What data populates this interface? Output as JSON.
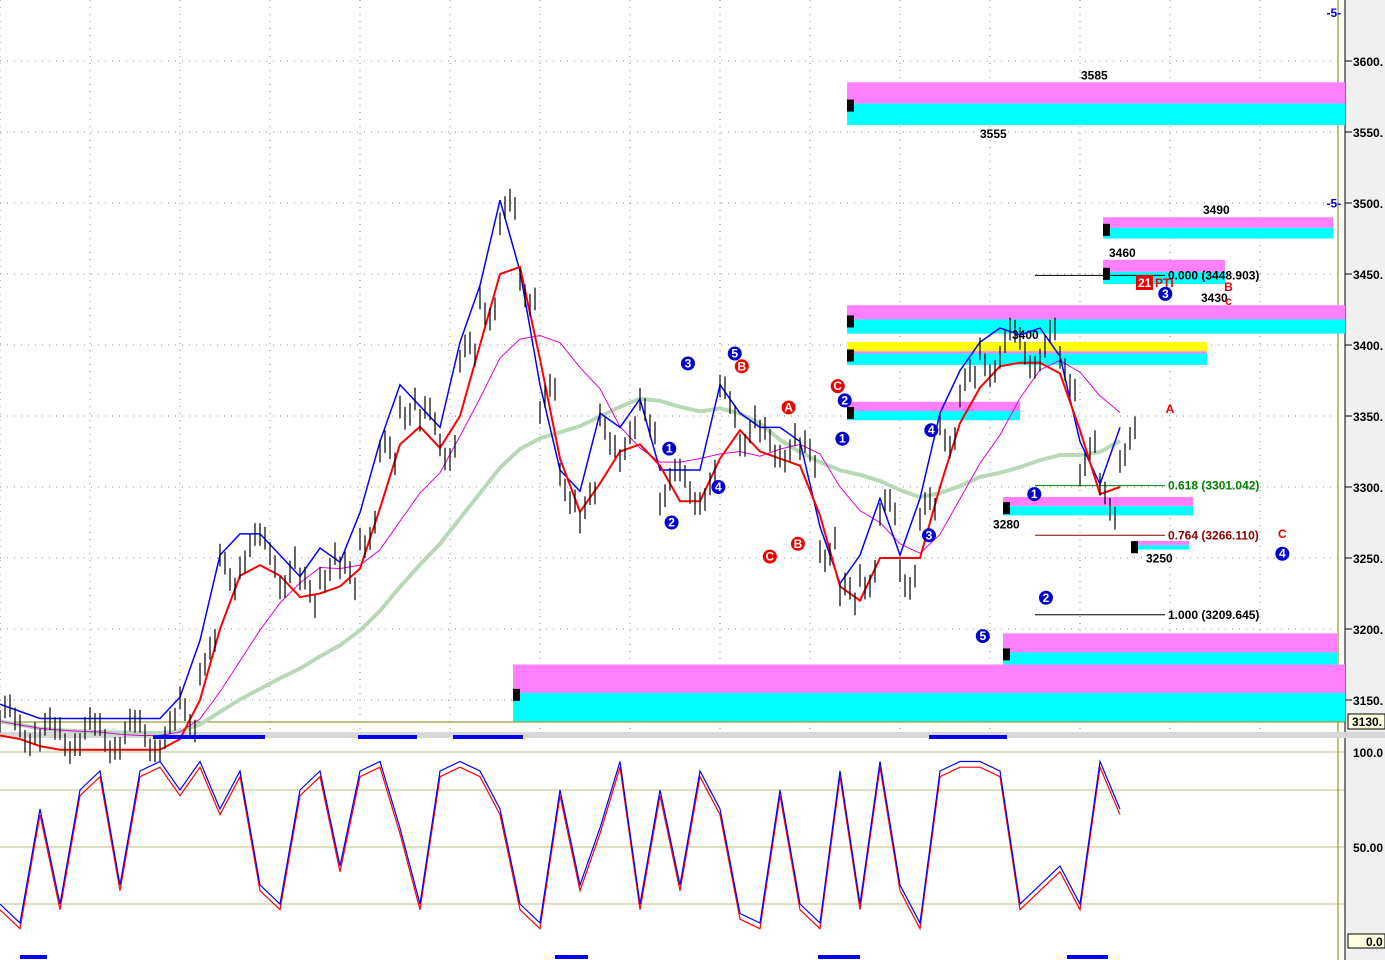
{
  "chart_data": {
    "type": "line",
    "title": "",
    "price_axis": {
      "ticks": [
        3600,
        3550,
        3500,
        3450,
        3400,
        3350,
        3300,
        3250,
        3200,
        3150
      ],
      "tick_labels": [
        "3600.",
        "3550.",
        "3500.",
        "3450.",
        "3400.",
        "3350.",
        "3300.",
        "3250.",
        "3200.",
        "3150."
      ],
      "current_label": "3130.",
      "ylim": [
        3125,
        3640
      ]
    },
    "osc_axis": {
      "ticks": [
        100,
        50
      ],
      "tick_labels": [
        "100.0",
        "50.00"
      ],
      "current_label": "0.0",
      "ylim": [
        0,
        110
      ]
    },
    "bars": 57,
    "series": [
      {
        "name": "price",
        "color": "#000000",
        "values": [
          3135,
          3130,
          3125,
          3125,
          3125,
          3125,
          3125,
          3125,
          3125,
          3140,
          3180,
          3240,
          3255,
          3255,
          3240,
          3225,
          3245,
          3235,
          3270,
          3320,
          3360,
          3345,
          3330,
          3390,
          3430,
          3490,
          3440,
          3360,
          3300,
          3285,
          3340,
          3330,
          3350,
          3300,
          3300,
          3300,
          3360,
          3340,
          3330,
          3330,
          3320,
          3260,
          3220,
          3240,
          3280,
          3240,
          3280,
          3340,
          3370,
          3390,
          3400,
          3395,
          3400,
          3380,
          3320,
          3290,
          3330
        ]
      },
      {
        "name": "osc_k",
        "color": "#0000ff",
        "values": [
          20,
          10,
          70,
          20,
          80,
          90,
          30,
          90,
          95,
          80,
          95,
          70,
          90,
          30,
          20,
          80,
          90,
          40,
          90,
          95,
          60,
          20,
          90,
          95,
          90,
          70,
          20,
          10,
          80,
          30,
          60,
          95,
          20,
          80,
          30,
          90,
          70,
          15,
          10,
          80,
          20,
          10,
          90,
          20,
          95,
          30,
          10,
          90,
          95,
          95,
          90,
          20,
          30,
          40,
          20,
          95,
          70
        ]
      }
    ],
    "zones": [
      {
        "top": 3585,
        "bottom": 3555,
        "label_top": "3585",
        "label_bottom": "3555"
      },
      {
        "top": 3490,
        "bottom": 3475,
        "label_top": "3490"
      },
      {
        "top": 3460,
        "bottom": 3443,
        "label_top": "3460"
      },
      {
        "top": 3428,
        "bottom": 3408,
        "label_top": "3430"
      },
      {
        "top": 3402,
        "bottom": 3386,
        "label_top": "3400"
      },
      {
        "top": 3360,
        "bottom": 3347
      },
      {
        "top": 3293,
        "bottom": 3280,
        "label_bottom": "3280"
      },
      {
        "top": 3262,
        "bottom": 3256,
        "label_bottom": "3250"
      },
      {
        "top": 3197,
        "bottom": 3170
      },
      {
        "top": 3175,
        "bottom": 3135
      }
    ],
    "fib_levels": [
      {
        "label": "0.000 (3448.903)",
        "price": 3449,
        "color": "#000000"
      },
      {
        "label": "0.618 (3301.042)",
        "price": 3301,
        "color": "#008000"
      },
      {
        "label": "0.764 (3266.110)",
        "price": 3266,
        "color": "#8b0000"
      },
      {
        "label": "1.000 (3209.645)",
        "price": 3210,
        "color": "#000000"
      }
    ],
    "wave_labels": [
      {
        "text": "2",
        "bar": 28.7,
        "price": 3275,
        "style": "blue-circle"
      },
      {
        "text": "1",
        "bar": 28.6,
        "price": 3327,
        "style": "blue-circle"
      },
      {
        "text": "3",
        "bar": 29.4,
        "price": 3387,
        "style": "blue-circle"
      },
      {
        "text": "4",
        "bar": 30.7,
        "price": 3300,
        "style": "blue-circle"
      },
      {
        "text": "5",
        "bar": 31.4,
        "price": 3394,
        "style": "blue-circle"
      },
      {
        "text": "B",
        "bar": 31.7,
        "price": 3385,
        "style": "red-circle"
      },
      {
        "text": "A",
        "bar": 33.7,
        "price": 3356,
        "style": "red-circle"
      },
      {
        "text": "C",
        "bar": 32.9,
        "price": 3251,
        "style": "red-circle"
      },
      {
        "text": "B",
        "bar": 34.1,
        "price": 3260,
        "style": "red-circle"
      },
      {
        "text": "C",
        "bar": 35.8,
        "price": 3371,
        "style": "red-circle"
      },
      {
        "text": "2",
        "bar": 36.1,
        "price": 3361,
        "style": "blue-circle"
      },
      {
        "text": "1",
        "bar": 36.0,
        "price": 3334,
        "style": "blue-circle"
      },
      {
        "text": "4",
        "bar": 39.8,
        "price": 3340,
        "style": "blue-circle"
      },
      {
        "text": "3",
        "bar": 39.7,
        "price": 3266,
        "style": "blue-circle"
      },
      {
        "text": "5",
        "bar": 42.0,
        "price": 3195,
        "style": "blue-circle"
      },
      {
        "text": "1",
        "bar": 44.2,
        "price": 3295,
        "style": "blue-circle"
      },
      {
        "text": "2",
        "bar": 44.7,
        "price": 3222,
        "style": "blue-circle"
      },
      {
        "text": "3",
        "bar": 49.8,
        "price": 3436,
        "style": "blue-circle"
      },
      {
        "text": "4",
        "bar": 54.8,
        "price": 3253,
        "style": "blue-circle"
      },
      {
        "text": "B",
        "bar": 52.5,
        "price": 3438,
        "style": "red-text"
      },
      {
        "text": "c",
        "bar": 52.5,
        "price": 3428,
        "style": "red-text"
      },
      {
        "text": "C",
        "bar": 54.8,
        "price": 3264,
        "style": "red-text"
      },
      {
        "text": "A",
        "bar": 50.0,
        "price": 3352,
        "style": "red-text"
      },
      {
        "text": "-5-",
        "bar": 57,
        "price": 3631,
        "style": "blue-text"
      },
      {
        "text": "-5-",
        "bar": 57,
        "price": 3497,
        "style": "blue-text"
      }
    ],
    "annotation": {
      "badge": "21",
      "text": "PTI"
    }
  }
}
